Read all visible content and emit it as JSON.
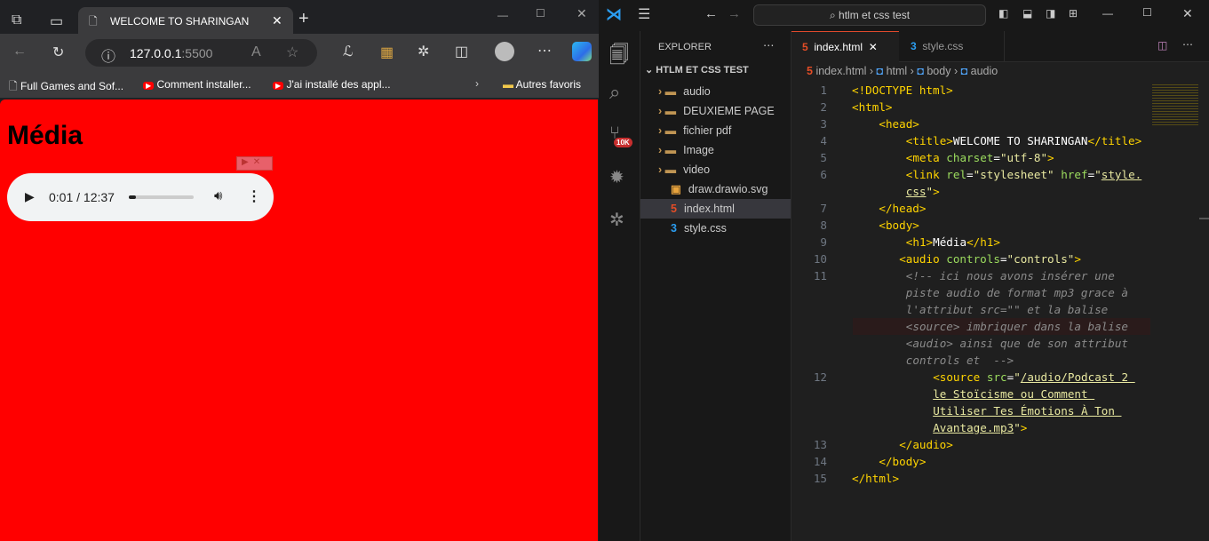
{
  "browser": {
    "tab_title": "WELCOME TO SHARINGAN",
    "url_host": "127.0.0.1",
    "url_port": ":5500",
    "bookmarks": [
      "Full Games and Sof...",
      "Comment installer...",
      "J'ai installé des appl..."
    ],
    "other_favorites": "Autres favoris",
    "page": {
      "heading": "Média",
      "player_time": "0:01 / 12:37",
      "progress": 0.0013
    }
  },
  "vscode": {
    "search": "htlm et css test",
    "explorer_title": "EXPLORER",
    "project": "HTLM ET CSS TEST",
    "badge": "10K",
    "tree": [
      {
        "label": "audio",
        "type": "folder"
      },
      {
        "label": "DEUXIEME PAGE",
        "type": "folder"
      },
      {
        "label": "fichier pdf",
        "type": "folder"
      },
      {
        "label": "Image",
        "type": "folder"
      },
      {
        "label": "video",
        "type": "folder"
      },
      {
        "label": "draw.drawio.svg",
        "type": "file"
      },
      {
        "label": "index.html",
        "type": "html",
        "selected": true
      },
      {
        "label": "style.css",
        "type": "css"
      }
    ],
    "tabs": [
      {
        "label": "index.html",
        "active": true
      },
      {
        "label": "style.css",
        "active": false
      }
    ],
    "breadcrumb": [
      "index.html",
      "html",
      "body",
      "audio"
    ],
    "code": [
      {
        "n": "1",
        "i": 0,
        "t": [
          [
            "tg",
            "<!DOCTYPE html>"
          ]
        ]
      },
      {
        "n": "2",
        "i": 0,
        "t": [
          [
            "tg",
            "<html>"
          ]
        ]
      },
      {
        "n": "3",
        "i": 4,
        "t": [
          [
            "tg",
            "<head>"
          ]
        ]
      },
      {
        "n": "4",
        "i": 8,
        "t": [
          [
            "tg",
            "<title>"
          ],
          [
            "tx",
            "WELCOME TO SHARINGAN"
          ],
          [
            "tg",
            "</title>"
          ]
        ]
      },
      {
        "n": "5",
        "i": 8,
        "t": [
          [
            "tg",
            "<meta "
          ],
          [
            "at",
            "charset"
          ],
          [
            "tx",
            "="
          ],
          [
            "st",
            "\"utf-8\""
          ],
          [
            "tg",
            ">"
          ]
        ]
      },
      {
        "n": "6",
        "i": 8,
        "t": [
          [
            "tg",
            "<link "
          ],
          [
            "at",
            "rel"
          ],
          [
            "tx",
            "="
          ],
          [
            "st",
            "\"stylesheet\" "
          ],
          [
            "at",
            "href"
          ],
          [
            "tx",
            "="
          ],
          [
            "st",
            "\""
          ],
          [
            "ul",
            "style."
          ]
        ]
      },
      {
        "n": "",
        "i": 8,
        "t": [
          [
            "ul",
            "css"
          ],
          [
            "st",
            "\""
          ],
          [
            "tg",
            ">"
          ]
        ]
      },
      {
        "n": "7",
        "i": 4,
        "t": [
          [
            "tg",
            "</head>"
          ]
        ]
      },
      {
        "n": "8",
        "i": 4,
        "t": [
          [
            "tg",
            "<body>"
          ]
        ]
      },
      {
        "n": "9",
        "i": 8,
        "t": [
          [
            "tg",
            "<h1>"
          ],
          [
            "tx",
            "Média"
          ],
          [
            "tg",
            "</h1>"
          ]
        ]
      },
      {
        "n": "10",
        "i": 7,
        "t": [
          [
            "tg",
            "<audio "
          ],
          [
            "at",
            "controls"
          ],
          [
            "tx",
            "="
          ],
          [
            "st",
            "\"controls\""
          ],
          [
            "tg",
            ">"
          ]
        ]
      },
      {
        "n": "11",
        "i": 8,
        "t": [
          [
            "cm",
            "<!-- ici nous avons insérer une"
          ]
        ]
      },
      {
        "n": "",
        "i": 8,
        "t": [
          [
            "cm",
            "piste audio de format mp3 grace à"
          ]
        ]
      },
      {
        "n": "",
        "i": 8,
        "t": [
          [
            "cm",
            "l'attribut src=\"\" et la balise"
          ]
        ]
      },
      {
        "n": "",
        "i": 8,
        "t": [
          [
            "cm",
            "<source> imbriquer dans la balise"
          ]
        ]
      },
      {
        "n": "",
        "i": 8,
        "t": [
          [
            "cm",
            "<audio> ainsi que de son attribut"
          ]
        ]
      },
      {
        "n": "",
        "i": 8,
        "t": [
          [
            "cm",
            "controls et  -->"
          ]
        ]
      },
      {
        "n": "12",
        "i": 12,
        "t": [
          [
            "tg",
            "<source "
          ],
          [
            "at",
            "src"
          ],
          [
            "tx",
            "="
          ],
          [
            "st",
            "\""
          ],
          [
            "ul",
            "/audio/Podcast 2 "
          ]
        ]
      },
      {
        "n": "",
        "i": 12,
        "t": [
          [
            "ul",
            "le Stoïcisme ou Comment "
          ]
        ]
      },
      {
        "n": "",
        "i": 12,
        "t": [
          [
            "ul",
            "Utiliser Tes Émotions À Ton "
          ]
        ]
      },
      {
        "n": "",
        "i": 12,
        "t": [
          [
            "ul",
            "Avantage.mp3"
          ],
          [
            "st",
            "\""
          ],
          [
            "tg",
            ">"
          ]
        ]
      },
      {
        "n": "13",
        "i": 7,
        "t": [
          [
            "tg",
            "</audio>"
          ]
        ]
      },
      {
        "n": "14",
        "i": 4,
        "t": [
          [
            "tg",
            "</body>"
          ]
        ]
      },
      {
        "n": "15",
        "i": 0,
        "t": [
          [
            "tg",
            "</html>"
          ]
        ]
      }
    ]
  }
}
